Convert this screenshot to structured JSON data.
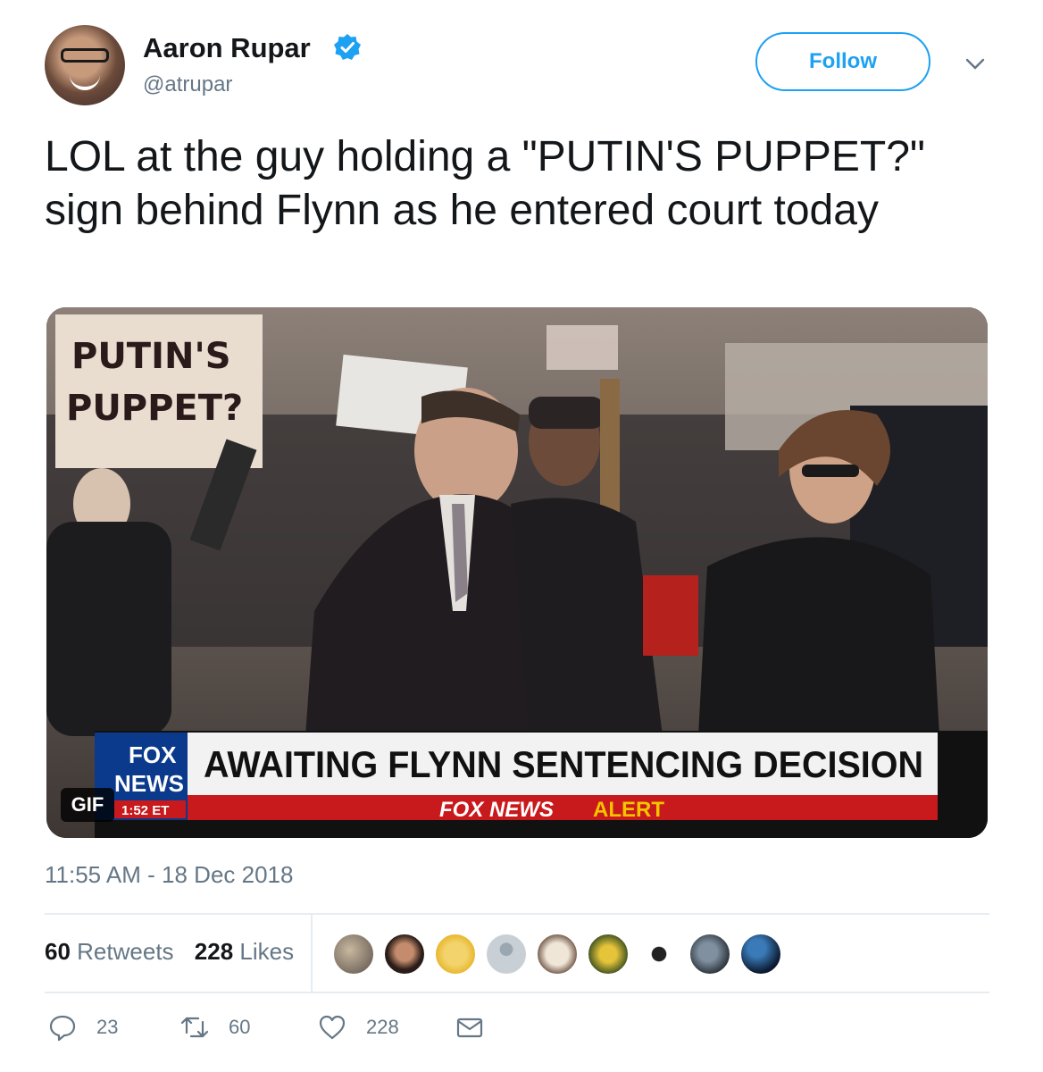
{
  "author": {
    "name": "Aaron Rupar",
    "handle": "@atrupar",
    "verified": true
  },
  "follow_label": "Follow",
  "tweet": {
    "text": "LOL at the guy holding a \"PUTIN'S PUPPET?\" sign behind Flynn as he entered court today",
    "timestamp": "11:55 AM - 18 Dec 2018"
  },
  "media": {
    "sign_line1": "PUTIN'S",
    "sign_line2": "PUPPET?",
    "chyron_headline": "AWAITING FLYNN SENTENCING DECISION",
    "chyron_alert_prefix": "FOX NEWS",
    "chyron_alert_word": "ALERT",
    "logo_top": "FOX",
    "logo_bottom": "NEWS",
    "clock": "1:52 ET",
    "badge": "GIF"
  },
  "stats": {
    "retweets_count": "60",
    "retweets_label": "Retweets",
    "likes_count": "228",
    "likes_label": "Likes"
  },
  "actions": {
    "reply_count": "23",
    "retweet_count": "60",
    "like_count": "228"
  },
  "colors": {
    "accent": "#1da1f2",
    "secondary_text": "#657786",
    "divider": "#e6ecf0",
    "chyron_red": "#c8191c"
  }
}
